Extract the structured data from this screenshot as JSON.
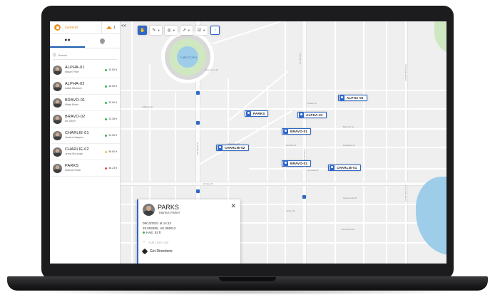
{
  "sidebar": {
    "group_name": "General",
    "layer_count": "1",
    "search_placeholder": "Search",
    "collapse_label": "<<",
    "units": [
      {
        "name": "ALPHA-01",
        "person": "Mason Price",
        "distance": "33.80 ft",
        "status_color": "#34b24a"
      },
      {
        "name": "ALPHA-02",
        "person": "Isabel Bismach",
        "distance": "45.60 ft",
        "status_color": "#34b24a"
      },
      {
        "name": "BRAVO-01",
        "person": "Mikey Bravo",
        "distance": "32.60 ft",
        "status_color": "#34b24a"
      },
      {
        "name": "BRAVO-02",
        "person": "Mo Oliver",
        "distance": "22.38 ft",
        "status_color": "#34b24a"
      },
      {
        "name": "CHARLIE-01",
        "person": "Jessica Vasquez",
        "distance": "22.50 ft",
        "status_color": "#34b24a"
      },
      {
        "name": "CHARLIE-02",
        "person": "Jenny McLaugh",
        "distance": "95.60 ft",
        "status_color": "#f2c230"
      },
      {
        "name": "PARKS",
        "person": "Markus Parker",
        "distance": "56.23 ft",
        "status_color": "#e0463b"
      }
    ]
  },
  "map": {
    "lake_label": "Lake Como",
    "street_labels": [
      "Lake Como Dr",
      "Primrose Dr",
      "S Bumby Ave",
      "S Crystal Lake Dr",
      "Delaware St",
      "Dunkirk St",
      "Cornwall St",
      "Lake Arnold Pl",
      "Jersey St",
      "Kentucky Ave",
      "E Kaley St",
      "Ocean St",
      "Belmont St",
      "Cherokee Dr",
      "Hibiscus St"
    ],
    "markers": [
      {
        "label": "ALPHA-02"
      },
      {
        "label": "PARKS"
      },
      {
        "label": "ALPHA-01"
      },
      {
        "label": "BRAVO-01"
      },
      {
        "label": "CHARLIE-02"
      },
      {
        "label": "BRAVO-02"
      },
      {
        "label": "CHARLIE-01"
      }
    ]
  },
  "popup": {
    "name": "PARKS",
    "person": "Markus Parker",
    "timestamp": "09/13/2021 at 14:12",
    "coordinates": "28.553490, -81.366012",
    "hae": "HAE: 53 ft",
    "add_user_unit": "Add User Unit",
    "get_directions": "Get Directions"
  },
  "colors": {
    "accent": "#2f67c7",
    "group": "#f0922b",
    "status_ok": "#34b24a"
  }
}
